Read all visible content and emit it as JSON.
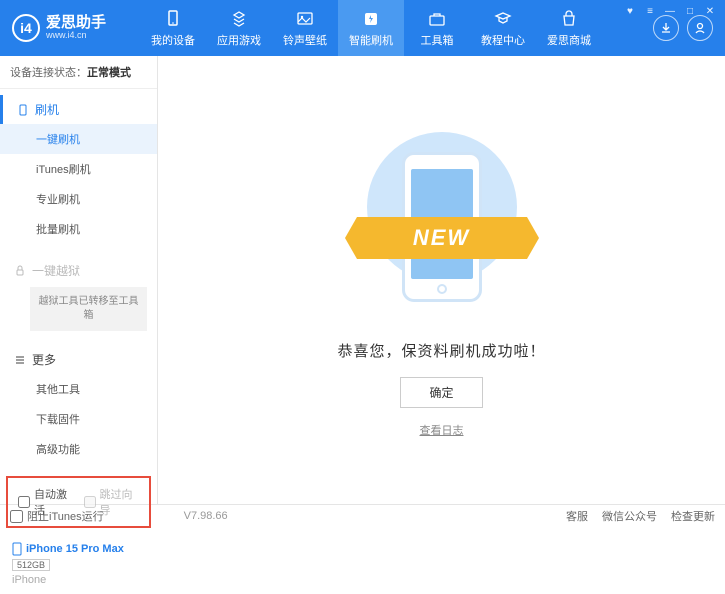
{
  "header": {
    "logo_title": "爱思助手",
    "logo_url": "www.i4.cn",
    "nav": [
      {
        "label": "我的设备"
      },
      {
        "label": "应用游戏"
      },
      {
        "label": "铃声壁纸"
      },
      {
        "label": "智能刷机"
      },
      {
        "label": "工具箱"
      },
      {
        "label": "教程中心"
      },
      {
        "label": "爱思商城"
      }
    ]
  },
  "sidebar": {
    "status_label": "设备连接状态：",
    "status_value": "正常模式",
    "flash_header": "刷机",
    "flash_items": [
      "一键刷机",
      "iTunes刷机",
      "专业刷机",
      "批量刷机"
    ],
    "jailbreak_header": "一键越狱",
    "jailbreak_note": "越狱工具已转移至工具箱",
    "more_header": "更多",
    "more_items": [
      "其他工具",
      "下载固件",
      "高级功能"
    ],
    "auto_activate": "自动激活",
    "skip_guide": "跳过向导",
    "device": {
      "name": "iPhone 15 Pro Max",
      "storage": "512GB",
      "type": "iPhone"
    }
  },
  "main": {
    "new_badge": "NEW",
    "success_text": "恭喜您，保资料刷机成功啦！",
    "ok_button": "确定",
    "view_log": "查看日志"
  },
  "footer": {
    "block_itunes": "阻止iTunes运行",
    "version": "V7.98.66",
    "links": [
      "客服",
      "微信公众号",
      "检查更新"
    ]
  }
}
